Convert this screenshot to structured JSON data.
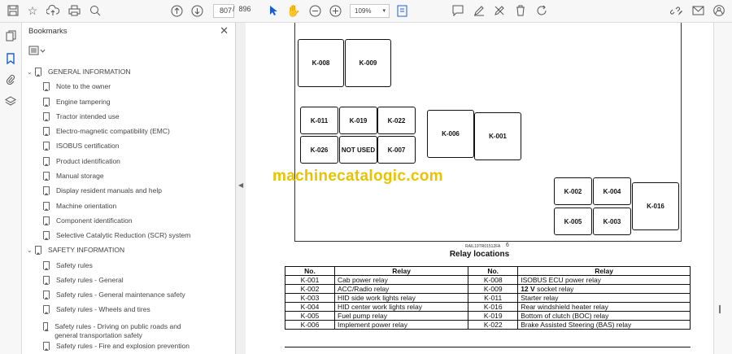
{
  "toolbar": {
    "current_page": "807",
    "page_separator": "/",
    "total_pages": "896",
    "zoom": "109%"
  },
  "panel": {
    "title": "Bookmarks"
  },
  "bookmarks": [
    {
      "label": "GENERAL INFORMATION",
      "level": 0
    },
    {
      "label": "Note to the owner",
      "level": 1
    },
    {
      "label": "Engine tampering",
      "level": 1
    },
    {
      "label": "Tractor intended use",
      "level": 1
    },
    {
      "label": "Electro-magnetic compatibility (EMC)",
      "level": 1
    },
    {
      "label": "ISOBUS certification",
      "level": 1
    },
    {
      "label": "Product identification",
      "level": 1
    },
    {
      "label": "Manual storage",
      "level": 1
    },
    {
      "label": "Display resident manuals and help",
      "level": 1
    },
    {
      "label": "Machine orientation",
      "level": 1
    },
    {
      "label": "Component identification",
      "level": 1
    },
    {
      "label": "Selective Catalytic Reduction (SCR) system",
      "level": 1
    },
    {
      "label": "SAFETY INFORMATION",
      "level": 0
    },
    {
      "label": "Safety rules",
      "level": 1
    },
    {
      "label": "Safety rules - General",
      "level": 1
    },
    {
      "label": "Safety rules - General maintenance safety",
      "level": 1
    },
    {
      "label": "Safety rules - Wheels and tires",
      "level": 1
    },
    {
      "label": "Safety rules - Driving on public roads and general transportation safety",
      "level": 1
    },
    {
      "label": "Safety rules - Fire and explosion prevention",
      "level": 1
    }
  ],
  "diagram": {
    "relays": [
      "K-008",
      "K-009",
      "K-011",
      "K-019",
      "K-022",
      "K-026",
      "NOT USED",
      "K-007",
      "K-006",
      "K-001",
      "K-002",
      "K-004",
      "K-005",
      "K-003",
      "K-016"
    ],
    "watermark": "machinecatalogic.com",
    "ref_code": "RAIL19TR01512FA",
    "page_number": "6"
  },
  "caption": "Relay locations",
  "table": {
    "headers": [
      "No.",
      "Relay",
      "No.",
      "Relay"
    ],
    "rows": [
      [
        "K-001",
        "Cab power relay",
        "K-008",
        "ISOBUS ECU power relay"
      ],
      [
        "K-002",
        "ACC/Radio relay",
        "K-009",
        "12 V socket relay"
      ],
      [
        "K-003",
        "HID side work lights relay",
        "K-011",
        "Starter relay"
      ],
      [
        "K-004",
        "HID center work lights relay",
        "K-016",
        "Rear windshield heater relay"
      ],
      [
        "K-005",
        "Fuel pump relay",
        "K-019",
        "Bottom of clutch (BOC) relay"
      ],
      [
        "K-006",
        "Implement power relay",
        "K-022",
        "Brake Assisted Steering (BAS) relay"
      ]
    ]
  }
}
